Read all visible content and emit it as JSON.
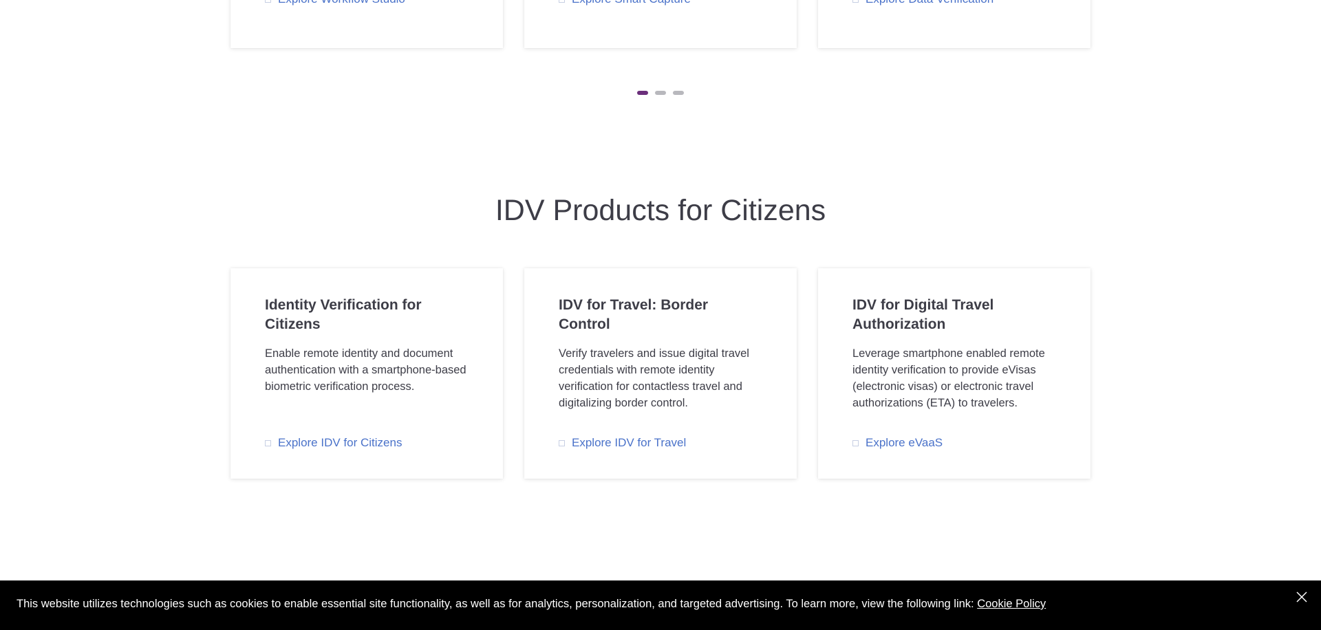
{
  "carousel_top": {
    "cards": [
      {
        "link_label": "Explore Workflow Studio",
        "link_icon": "square-outline-icon"
      },
      {
        "link_label": "Explore Smart Capture",
        "link_icon": "square-outline-icon"
      },
      {
        "link_label": "Explore Data Verification",
        "link_icon": "square-outline-icon"
      }
    ],
    "pagination": {
      "total": 3,
      "active_index": 0,
      "active_color": "#6b2f7b",
      "inactive_color": "#b8b8bd"
    }
  },
  "citizens_section": {
    "title": "IDV Products for Citizens",
    "cards": [
      {
        "title": "Identity Verification for Citizens",
        "description": "Enable remote identity and document authentication with a smartphone-based biometric verification process.",
        "link_label": "Explore IDV for Citizens"
      },
      {
        "title": "IDV for Travel: Border Control",
        "description": "Verify travelers and issue digital travel credentials with remote identity verification for contactless travel and digitalizing border control.",
        "link_label": "Explore IDV for Travel"
      },
      {
        "title": "IDV for Digital Travel Authorization",
        "description": "Leverage smartphone enabled remote identity verification to provide eVisas (electronic visas) or electronic travel authorizations (ETA) to travelers.",
        "link_label": "Explore eVaaS"
      }
    ]
  },
  "cookie_banner": {
    "text": "This website utilizes technologies such as cookies to enable essential site functionality, as well as for analytics, personalization, and targeted advertising. To learn more, view the following link: ",
    "link_label": "Cookie Policy",
    "close_icon": "close-icon",
    "background": "#000000"
  },
  "colors": {
    "link": "#4a72c9",
    "text": "#3d3d47"
  }
}
